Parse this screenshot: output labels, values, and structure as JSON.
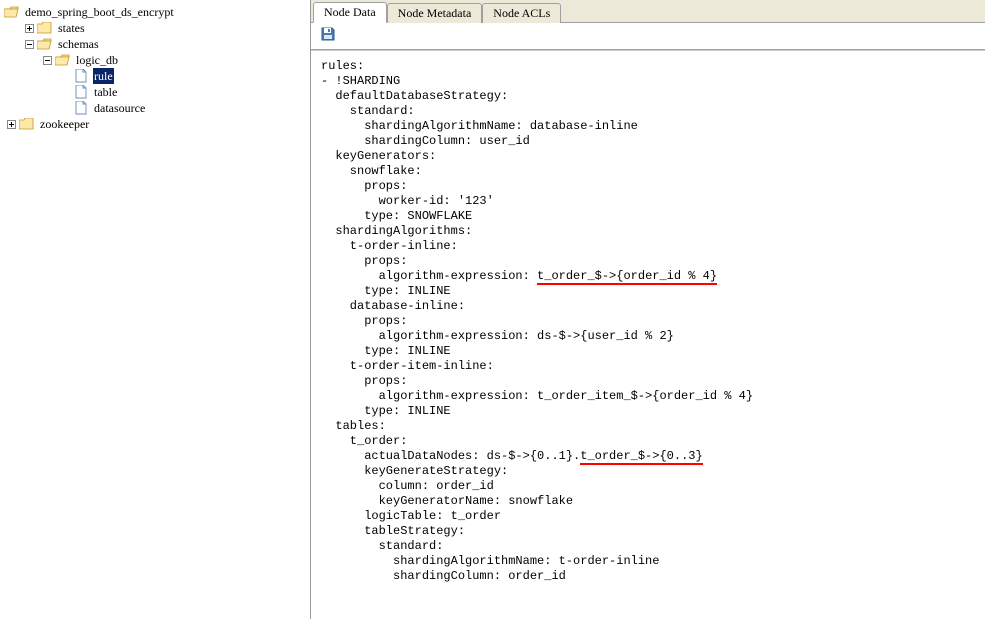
{
  "tree": {
    "root": "demo_spring_boot_ds_encrypt",
    "root_children": {
      "states": "states",
      "schemas": "schemas",
      "logic_db": "logic_db",
      "rule": "rule",
      "table": "table",
      "datasource": "datasource"
    },
    "sibling": "zookeeper"
  },
  "tabs": {
    "data": "Node Data",
    "metadata": "Node Metadata",
    "acls": "Node ACLs"
  },
  "editor": {
    "l1": "rules:",
    "l2": "- !SHARDING",
    "l3": "  defaultDatabaseStrategy:",
    "l4": "    standard:",
    "l5": "      shardingAlgorithmName: database-inline",
    "l6": "      shardingColumn: user_id",
    "l7": "  keyGenerators:",
    "l8": "    snowflake:",
    "l9": "      props:",
    "l10": "        worker-id: '123'",
    "l11": "      type: SNOWFLAKE",
    "l12": "  shardingAlgorithms:",
    "l13": "    t-order-inline:",
    "l14": "      props:",
    "l15a": "        algorithm-expression: ",
    "l15b": "t_order_$->{order_id % 4}",
    "l16": "      type: INLINE",
    "l17": "    database-inline:",
    "l18": "      props:",
    "l19": "        algorithm-expression: ds-$->{user_id % 2}",
    "l20": "      type: INLINE",
    "l21": "    t-order-item-inline:",
    "l22": "      props:",
    "l23": "        algorithm-expression: t_order_item_$->{order_id % 4}",
    "l24": "      type: INLINE",
    "l25": "  tables:",
    "l26": "    t_order:",
    "l27a": "      actualDataNodes: ds-$->{0..1}.",
    "l27b": "t_order_$->{0..3}",
    "l28": "      keyGenerateStrategy:",
    "l29": "        column: order_id",
    "l30": "        keyGeneratorName: snowflake",
    "l31": "      logicTable: t_order",
    "l32": "      tableStrategy:",
    "l33": "        standard:",
    "l34": "          shardingAlgorithmName: t-order-inline",
    "l35": "          shardingColumn: order_id"
  }
}
